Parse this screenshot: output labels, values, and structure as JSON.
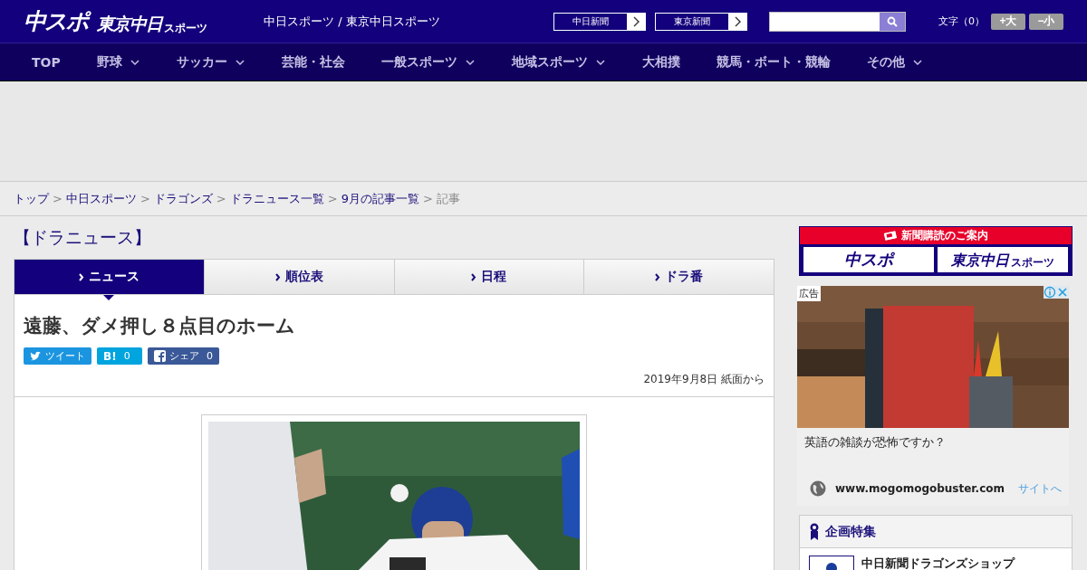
{
  "header": {
    "logo": "中スポ",
    "logo2": "東京中日",
    "logo2_small": "スポーツ",
    "site_title": "中日スポーツ / 東京中日スポーツ",
    "links": [
      {
        "label": "中日新聞"
      },
      {
        "label": "東京新聞"
      }
    ],
    "font_size": {
      "label": "文字（0）",
      "buttons": [
        "+大",
        "−小"
      ]
    }
  },
  "nav": [
    {
      "label": "TOP",
      "dropdown": false
    },
    {
      "label": "野球",
      "dropdown": true
    },
    {
      "label": "サッカー",
      "dropdown": true
    },
    {
      "label": "芸能・社会",
      "dropdown": false
    },
    {
      "label": "一般スポーツ",
      "dropdown": true
    },
    {
      "label": "地域スポーツ",
      "dropdown": true
    },
    {
      "label": "大相撲",
      "dropdown": false
    },
    {
      "label": "競馬・ボート・競輪",
      "dropdown": false
    },
    {
      "label": "その他",
      "dropdown": true
    }
  ],
  "breadcrumb_separator": ">",
  "breadcrumb": [
    {
      "label": "トップ",
      "kind": "link"
    },
    {
      "label": "中日スポーツ",
      "kind": "link"
    },
    {
      "label": "ドラゴンズ",
      "kind": "link"
    },
    {
      "label": "ドラニュース一覧",
      "kind": "link"
    },
    {
      "label": "9月の記事一覧",
      "kind": "link"
    },
    {
      "label": "記事",
      "kind": "current"
    }
  ],
  "section_title": "【ドラニュース】",
  "tabs": [
    {
      "label": "ニュース",
      "selected": true
    },
    {
      "label": "順位表",
      "selected": false
    },
    {
      "label": "日程",
      "selected": false
    },
    {
      "label": "ドラ番",
      "selected": false
    }
  ],
  "article": {
    "title": "遠藤、ダメ押し８点目のホーム",
    "share": [
      {
        "kind": "twitter",
        "label": "ツイート"
      },
      {
        "kind": "hatena",
        "label": "B!",
        "count": "0"
      },
      {
        "kind": "facebook",
        "label": "シェア",
        "count": "0"
      }
    ],
    "date": "2019年9月8日 紙面から"
  },
  "sidebar": {
    "subscribe": {
      "title": "新聞購読のご案内",
      "logo": "中スポ",
      "logo2": "東京中日",
      "logo2_small": "スポーツ"
    },
    "ad": {
      "badge": "広告",
      "text": "英語の雑談が恐怖ですか？",
      "url": "www.mogomogobuster.com",
      "link": "サイトへ"
    },
    "feature": {
      "title": "企画特集",
      "items": [
        "中日新聞ドラゴンズショップ"
      ]
    }
  }
}
